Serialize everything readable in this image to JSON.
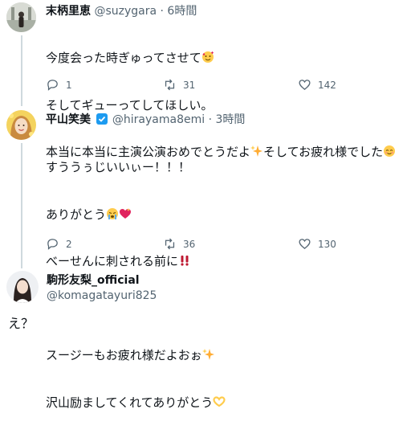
{
  "tweet1": {
    "name": "末柄里恵",
    "handle": "@suzygara",
    "sep": "·",
    "time": "6時間",
    "line1": "今度会った時ぎゅってさせて",
    "line2": "そしてギューってしてほしい。",
    "line3": "本当に本当に主演公演おめでとうだよ",
    "line3b": "そしてお疲れ様でした",
    "replies": "1",
    "retweets": "31",
    "likes": "142"
  },
  "tweet2": {
    "name": "平山笑美",
    "handle": "@hirayama8emi",
    "sep": "·",
    "time": "3時間",
    "line1": "すううぅじいいぃー！！！",
    "line2": "ありがとう",
    "line3": "べーせんに刺される前に",
    "line4": "スージーもお疲れ様だよおぉ",
    "line5": "沢山励ましてくれてありがとう",
    "replies": "2",
    "retweets": "36",
    "likes": "130"
  },
  "tweet3": {
    "name": "駒形友梨_official",
    "handle": "@komagatayuri825",
    "text": "え？"
  },
  "colors": {
    "text": "#0f1419",
    "secondary": "#536471",
    "verified": "#1d9bf0",
    "thread_line": "#cfd9de"
  }
}
